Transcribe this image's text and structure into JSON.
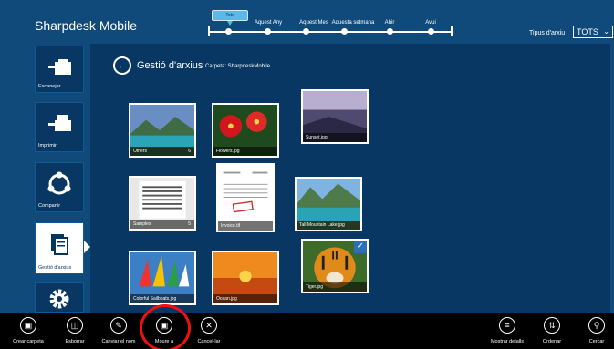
{
  "app": {
    "title": "Sharpdesk Mobile"
  },
  "timeline": {
    "active_label": "Tots",
    "labels": [
      "Aquest Any",
      "Aquest Mes",
      "Aquesta setmana",
      "Ahir",
      "Avui"
    ]
  },
  "filter": {
    "label": "Tipus d'arxiu",
    "value": "TOTS"
  },
  "sidebar": {
    "items": [
      {
        "label": "Escanejar",
        "icon": "scan-icon"
      },
      {
        "label": "Imprimir",
        "icon": "print-icon"
      },
      {
        "label": "Compartir",
        "icon": "share-icon"
      },
      {
        "label": "Gestió d'arxius",
        "icon": "file-management-icon",
        "active": true
      },
      {
        "label": "",
        "icon": "settings-gear-icon"
      }
    ]
  },
  "header": {
    "title": "Gestió d'arxius",
    "folder": "Carpeta: SharpdeskMobile"
  },
  "files": [
    {
      "name": "Others",
      "count": "6",
      "kind": "folder"
    },
    {
      "name": "Flowers.jpg",
      "kind": "image"
    },
    {
      "name": "Sunset.jpg",
      "kind": "image"
    },
    {
      "name": "Samples",
      "count": "5",
      "kind": "folder"
    },
    {
      "name": "Invoice.tif",
      "kind": "document"
    },
    {
      "name": "Tall Mountain Lake.jpg",
      "kind": "image"
    },
    {
      "name": "Colorful Sailboats.jpg",
      "kind": "image"
    },
    {
      "name": "Ocean.jpg",
      "kind": "image"
    },
    {
      "name": "Tiger.jpg",
      "kind": "image",
      "selected": true
    }
  ],
  "appbar": {
    "left": [
      {
        "label": "Crear carpeta",
        "icon": "new-folder-icon"
      },
      {
        "label": "Esborrar",
        "icon": "delete-icon"
      },
      {
        "label": "Canviar el nom",
        "icon": "rename-icon"
      },
      {
        "label": "Moure a",
        "icon": "move-to-icon"
      },
      {
        "label": "Cancel·lar",
        "icon": "cancel-icon"
      }
    ],
    "right": [
      {
        "label": "Mostrar detalls",
        "icon": "details-icon"
      },
      {
        "label": "Ordenar",
        "icon": "sort-icon"
      },
      {
        "label": "Cercar",
        "icon": "search-icon"
      }
    ]
  },
  "colors": {
    "background": "#0f4a7a",
    "content": "#073762",
    "accent": "#5cb8e8",
    "highlight_ring": "#e11111"
  }
}
